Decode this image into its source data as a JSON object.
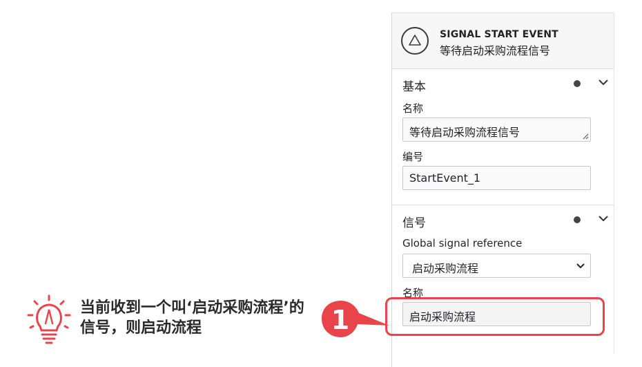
{
  "header": {
    "type_label": "SIGNAL START EVENT",
    "element_name": "等待启动采购流程信号",
    "icon": "signal-triangle-icon"
  },
  "groups": {
    "basic": {
      "title": "基本",
      "name_label": "名称",
      "name_value": "等待启动采购流程信号",
      "id_label": "编号",
      "id_value": "StartEvent_1"
    },
    "signal": {
      "title": "信号",
      "ref_label": "Global signal reference",
      "ref_value": "启动采购流程",
      "name_label": "名称",
      "name_value": "启动采购流程"
    }
  },
  "callout": {
    "text": "当前收到一个叫‘启动采购流程’的信号，则启动流程",
    "step_number": "1",
    "icon": "lightbulb-icon"
  },
  "colors": {
    "accent_red": "#e8444a",
    "header_bg": "#f7f7f8"
  }
}
